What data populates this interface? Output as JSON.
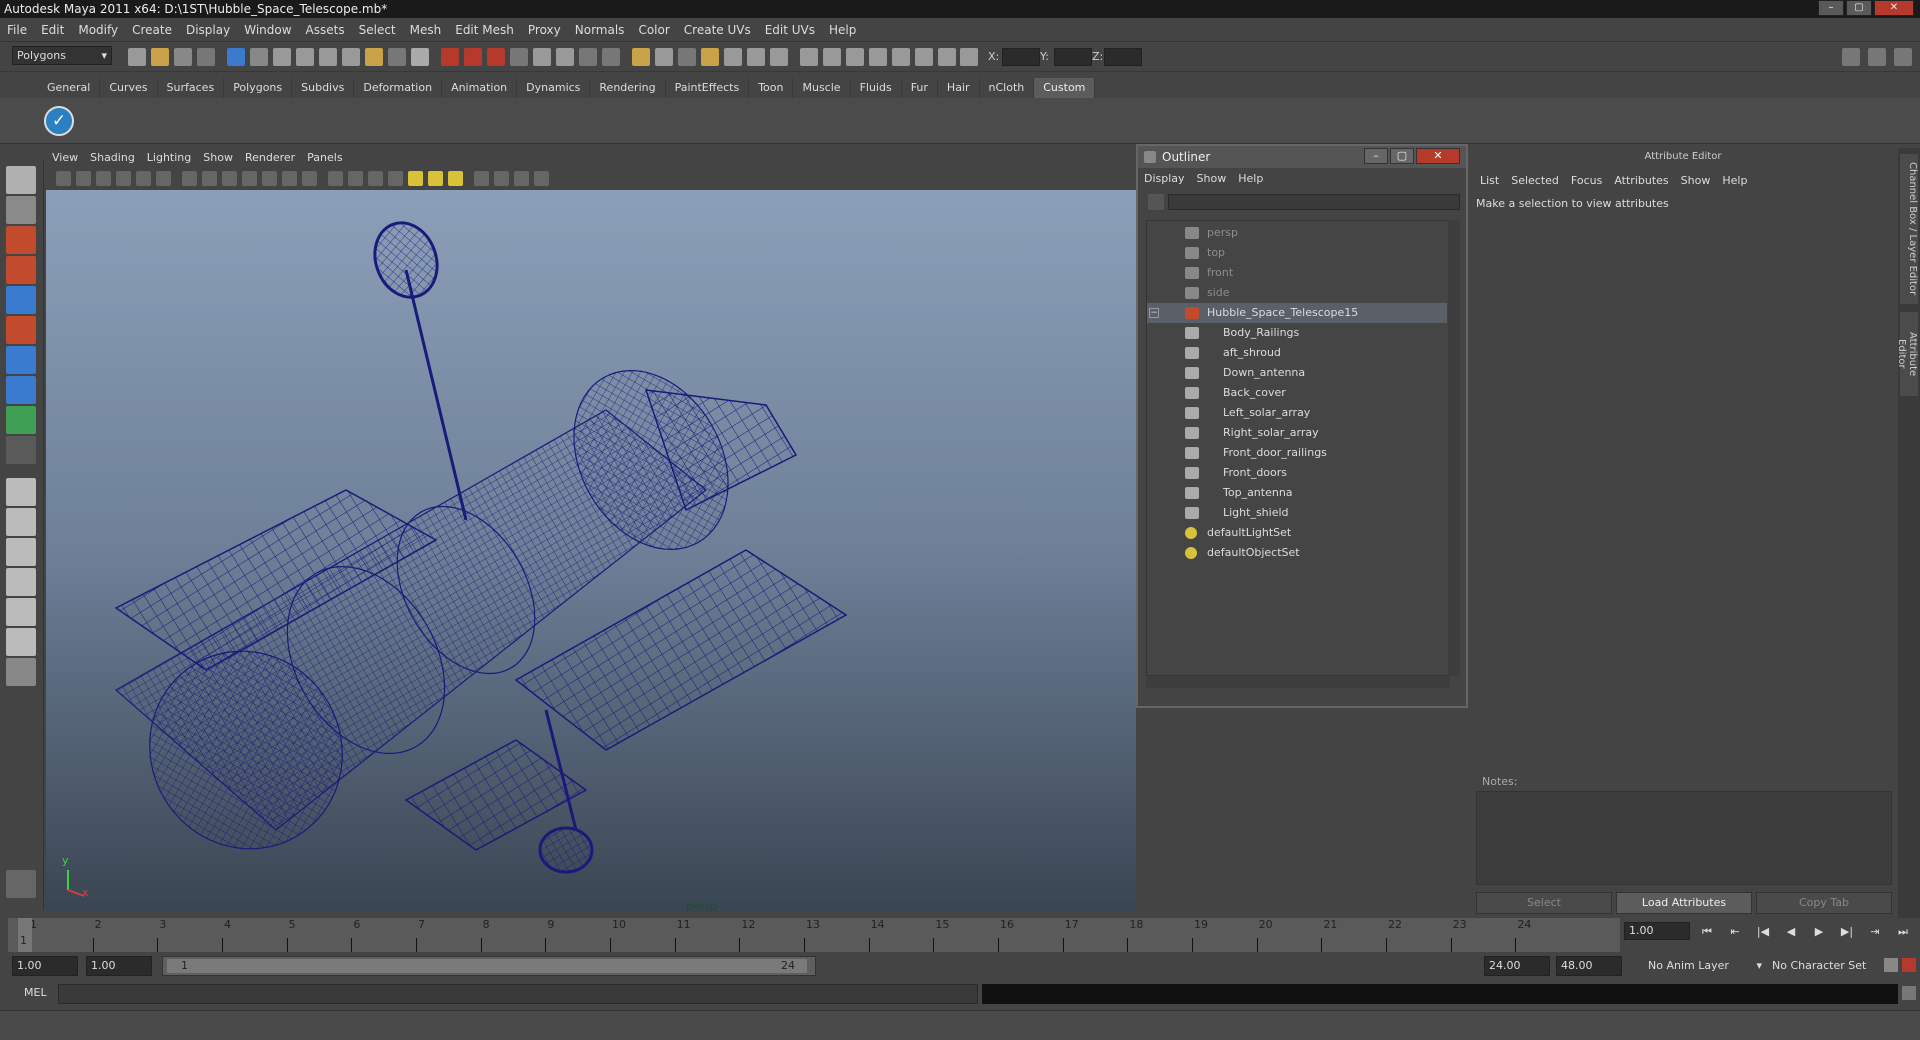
{
  "window": {
    "title": "Autodesk Maya 2011 x64: D:\\1ST\\Hubble_Space_Telescope.mb*",
    "minimize_icon": "minimize-icon",
    "maximize_icon": "maximize-icon",
    "close_icon": "close-icon"
  },
  "menubar": [
    "File",
    "Edit",
    "Modify",
    "Create",
    "Display",
    "Window",
    "Assets",
    "Select",
    "Mesh",
    "Edit Mesh",
    "Proxy",
    "Normals",
    "Color",
    "Create UVs",
    "Edit UVs",
    "Help"
  ],
  "statusline": {
    "mode": "Polygons",
    "x_label": "X:",
    "y_label": "Y:",
    "z_label": "Z:"
  },
  "shelf": {
    "tabs": [
      "General",
      "Curves",
      "Surfaces",
      "Polygons",
      "Subdivs",
      "Deformation",
      "Animation",
      "Dynamics",
      "Rendering",
      "PaintEffects",
      "Toon",
      "Muscle",
      "Fluids",
      "Fur",
      "Hair",
      "nCloth",
      "Custom"
    ],
    "active_tab": "Custom"
  },
  "viewport": {
    "menu": [
      "View",
      "Shading",
      "Lighting",
      "Show",
      "Renderer",
      "Panels"
    ],
    "camera_label": "persp",
    "axis_x": "x",
    "axis_y": "y",
    "wire_color": "#1a1a7a"
  },
  "outliner": {
    "title": "Outliner",
    "menu": [
      "Display",
      "Show",
      "Help"
    ],
    "items": [
      {
        "label": "persp",
        "dim": true,
        "indent": 0,
        "icon": "camera-icon"
      },
      {
        "label": "top",
        "dim": true,
        "indent": 0,
        "icon": "camera-icon"
      },
      {
        "label": "front",
        "dim": true,
        "indent": 0,
        "icon": "camera-icon"
      },
      {
        "label": "side",
        "dim": true,
        "indent": 0,
        "icon": "camera-icon"
      },
      {
        "label": "Hubble_Space_Telescope15",
        "dim": false,
        "indent": 0,
        "selected": true,
        "icon": "group-icon",
        "expanded": true
      },
      {
        "label": "Body_Railings",
        "dim": false,
        "indent": 1,
        "icon": "mesh-icon"
      },
      {
        "label": "aft_shroud",
        "dim": false,
        "indent": 1,
        "icon": "mesh-icon"
      },
      {
        "label": "Down_antenna",
        "dim": false,
        "indent": 1,
        "icon": "mesh-icon"
      },
      {
        "label": "Back_cover",
        "dim": false,
        "indent": 1,
        "icon": "mesh-icon"
      },
      {
        "label": "Left_solar_array",
        "dim": false,
        "indent": 1,
        "icon": "mesh-icon"
      },
      {
        "label": "Right_solar_array",
        "dim": false,
        "indent": 1,
        "icon": "mesh-icon"
      },
      {
        "label": "Front_door_railings",
        "dim": false,
        "indent": 1,
        "icon": "mesh-icon"
      },
      {
        "label": "Front_doors",
        "dim": false,
        "indent": 1,
        "icon": "mesh-icon"
      },
      {
        "label": "Top_antenna",
        "dim": false,
        "indent": 1,
        "icon": "mesh-icon"
      },
      {
        "label": "Light_shield",
        "dim": false,
        "indent": 1,
        "icon": "mesh-icon"
      },
      {
        "label": "defaultLightSet",
        "dim": false,
        "indent": 0,
        "icon": "set-icon"
      },
      {
        "label": "defaultObjectSet",
        "dim": false,
        "indent": 0,
        "icon": "set-icon"
      }
    ]
  },
  "attribute_editor": {
    "title": "Attribute Editor",
    "menu": [
      "List",
      "Selected",
      "Focus",
      "Attributes",
      "Show",
      "Help"
    ],
    "message": "Make a selection to view attributes",
    "notes_label": "Notes:",
    "buttons": {
      "select": "Select",
      "load": "Load Attributes",
      "copy_tab": "Copy Tab"
    },
    "side_tabs": [
      "Channel Box / Layer Editor",
      "Attribute Editor"
    ]
  },
  "timeline": {
    "frames": [
      1,
      2,
      3,
      4,
      5,
      6,
      7,
      8,
      9,
      10,
      11,
      12,
      13,
      14,
      15,
      16,
      17,
      18,
      19,
      20,
      21,
      22,
      23,
      24
    ],
    "current_frame_marker": "1",
    "current_time": "1.00"
  },
  "range": {
    "start_time": "1.00",
    "playback_start": "1.00",
    "slider_start": "1",
    "slider_end": "24",
    "playback_end": "24.00",
    "end_time": "48.00",
    "anim_layer": "No Anim Layer",
    "character_set": "No Character Set"
  },
  "cmdline": {
    "label": "MEL"
  },
  "colors": {
    "accent_shelf": "#5c5c5c",
    "outliner_selection": "#5a5f68",
    "viewport_top": "#8c9fb8",
    "viewport_bottom": "#3a4552",
    "wireframe": "#1a1a7a"
  }
}
